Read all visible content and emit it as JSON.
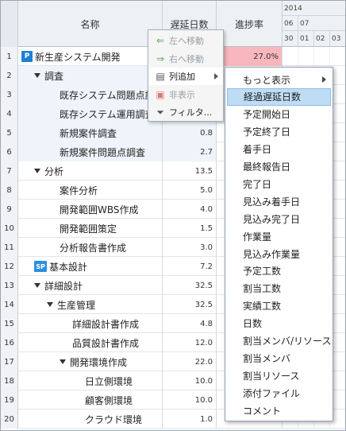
{
  "columns": {
    "name": "名称",
    "delay": "遅延日数",
    "progress": "進捗率"
  },
  "timeline": {
    "year": "2014",
    "month": "07",
    "prev_month": "06",
    "days": [
      "30",
      "01",
      "02",
      "03"
    ]
  },
  "rows": [
    {
      "num": "1",
      "name": "新生産システム開発",
      "badge": "P",
      "delay": "",
      "progress": "27.0%",
      "progress_fill": 1.0,
      "indent": 0,
      "toggle": false
    },
    {
      "num": "2",
      "name": "調査",
      "badge": "",
      "delay": "",
      "progress": "",
      "progress_fill": 0,
      "indent": 1,
      "toggle": true
    },
    {
      "num": "3",
      "name": "既存システム問題点調査",
      "badge": "",
      "delay": "",
      "progress": "",
      "progress_fill": 0,
      "indent": 3,
      "toggle": false
    },
    {
      "num": "4",
      "name": "既存システム運用調査",
      "badge": "",
      "delay": "",
      "progress": "",
      "progress_fill": 0,
      "indent": 3,
      "toggle": false
    },
    {
      "num": "5",
      "name": "新規案件調査",
      "badge": "",
      "delay": "0.8",
      "progress": "",
      "progress_fill": 0,
      "indent": 3,
      "toggle": false
    },
    {
      "num": "6",
      "name": "新規案件問題点調査",
      "badge": "",
      "delay": "2.7",
      "progress": "",
      "progress_fill": 0,
      "indent": 3,
      "toggle": false
    },
    {
      "num": "7",
      "name": "分析",
      "badge": "",
      "delay": "13.5",
      "progress": "",
      "progress_fill": 0,
      "indent": 1,
      "toggle": true
    },
    {
      "num": "8",
      "name": "案件分析",
      "badge": "",
      "delay": "5.0",
      "progress": "",
      "progress_fill": 0,
      "indent": 3,
      "toggle": false
    },
    {
      "num": "9",
      "name": "開発範囲WBS作成",
      "badge": "",
      "delay": "4.0",
      "progress": "",
      "progress_fill": 0,
      "indent": 3,
      "toggle": false
    },
    {
      "num": "10",
      "name": "開発範囲策定",
      "badge": "",
      "delay": "1.5",
      "progress": "",
      "progress_fill": 0,
      "indent": 3,
      "toggle": false
    },
    {
      "num": "11",
      "name": "分析報告書作成",
      "badge": "",
      "delay": "3.0",
      "progress": "",
      "progress_fill": 0,
      "indent": 3,
      "toggle": false
    },
    {
      "num": "12",
      "name": "基本設計",
      "badge": "SP",
      "delay": "7.2",
      "progress": "",
      "progress_fill": 0,
      "indent": 1,
      "toggle": false
    },
    {
      "num": "13",
      "name": "詳細設計",
      "badge": "",
      "delay": "32.5",
      "progress": "",
      "progress_fill": 0,
      "indent": 1,
      "toggle": true
    },
    {
      "num": "14",
      "name": "生産管理",
      "badge": "",
      "delay": "32.5",
      "progress": "",
      "progress_fill": 0,
      "indent": 2,
      "toggle": true
    },
    {
      "num": "15",
      "name": "詳細設計書作成",
      "badge": "",
      "delay": "4.8",
      "progress": "",
      "progress_fill": 0,
      "indent": 4,
      "toggle": false
    },
    {
      "num": "16",
      "name": "品質設計書作成",
      "badge": "",
      "delay": "12.0",
      "progress": "",
      "progress_fill": 0,
      "indent": 4,
      "toggle": false
    },
    {
      "num": "17",
      "name": "開発環境作成",
      "badge": "",
      "delay": "22.0",
      "progress": "",
      "progress_fill": 0,
      "indent": 3,
      "toggle": true
    },
    {
      "num": "18",
      "name": "日立側環境",
      "badge": "",
      "delay": "10.0",
      "progress": "",
      "progress_fill": 0,
      "indent": 5,
      "toggle": false
    },
    {
      "num": "19",
      "name": "顧客側環境",
      "badge": "",
      "delay": "10.0",
      "progress": "",
      "progress_fill": 0,
      "indent": 5,
      "toggle": false
    },
    {
      "num": "20",
      "name": "クラウド環境",
      "badge": "",
      "delay": "1.0",
      "progress": "",
      "progress_fill": 0,
      "indent": 5,
      "toggle": false
    }
  ],
  "column_menu": {
    "items": [
      {
        "label": "左へ移動",
        "icon": "arrow-left-icon",
        "glyph": "⇐",
        "disabled": true
      },
      {
        "label": "右へ移動",
        "icon": "arrow-right-icon",
        "glyph": "⇒",
        "disabled": true
      },
      {
        "label": "列追加",
        "icon": "add-column-icon",
        "glyph": "▤",
        "disabled": false,
        "submenu": true
      },
      {
        "label": "非表示",
        "icon": "hide-column-icon",
        "glyph": "▣",
        "disabled": true
      },
      {
        "label": "フィルタ...",
        "icon": "filter-icon",
        "glyph": "⏷",
        "disabled": false
      }
    ]
  },
  "add_column_menu": {
    "items": [
      "もっと表示",
      "経過遅延日数",
      "予定開始日",
      "予定終了日",
      "着手日",
      "最終報告日",
      "完了日",
      "見込み着手日",
      "見込み完了日",
      "作業量",
      "見込み作業量",
      "予定工数",
      "割当工数",
      "実績工数",
      "日数",
      "割当メンバ/リソース",
      "割当メンバ",
      "割当リソース",
      "添付ファイル",
      "コメント"
    ],
    "active_index": 1
  },
  "colors": {
    "accent": "#1e7fd6",
    "progress": "#f7b7bd",
    "highlight": "#bfdcf5"
  }
}
